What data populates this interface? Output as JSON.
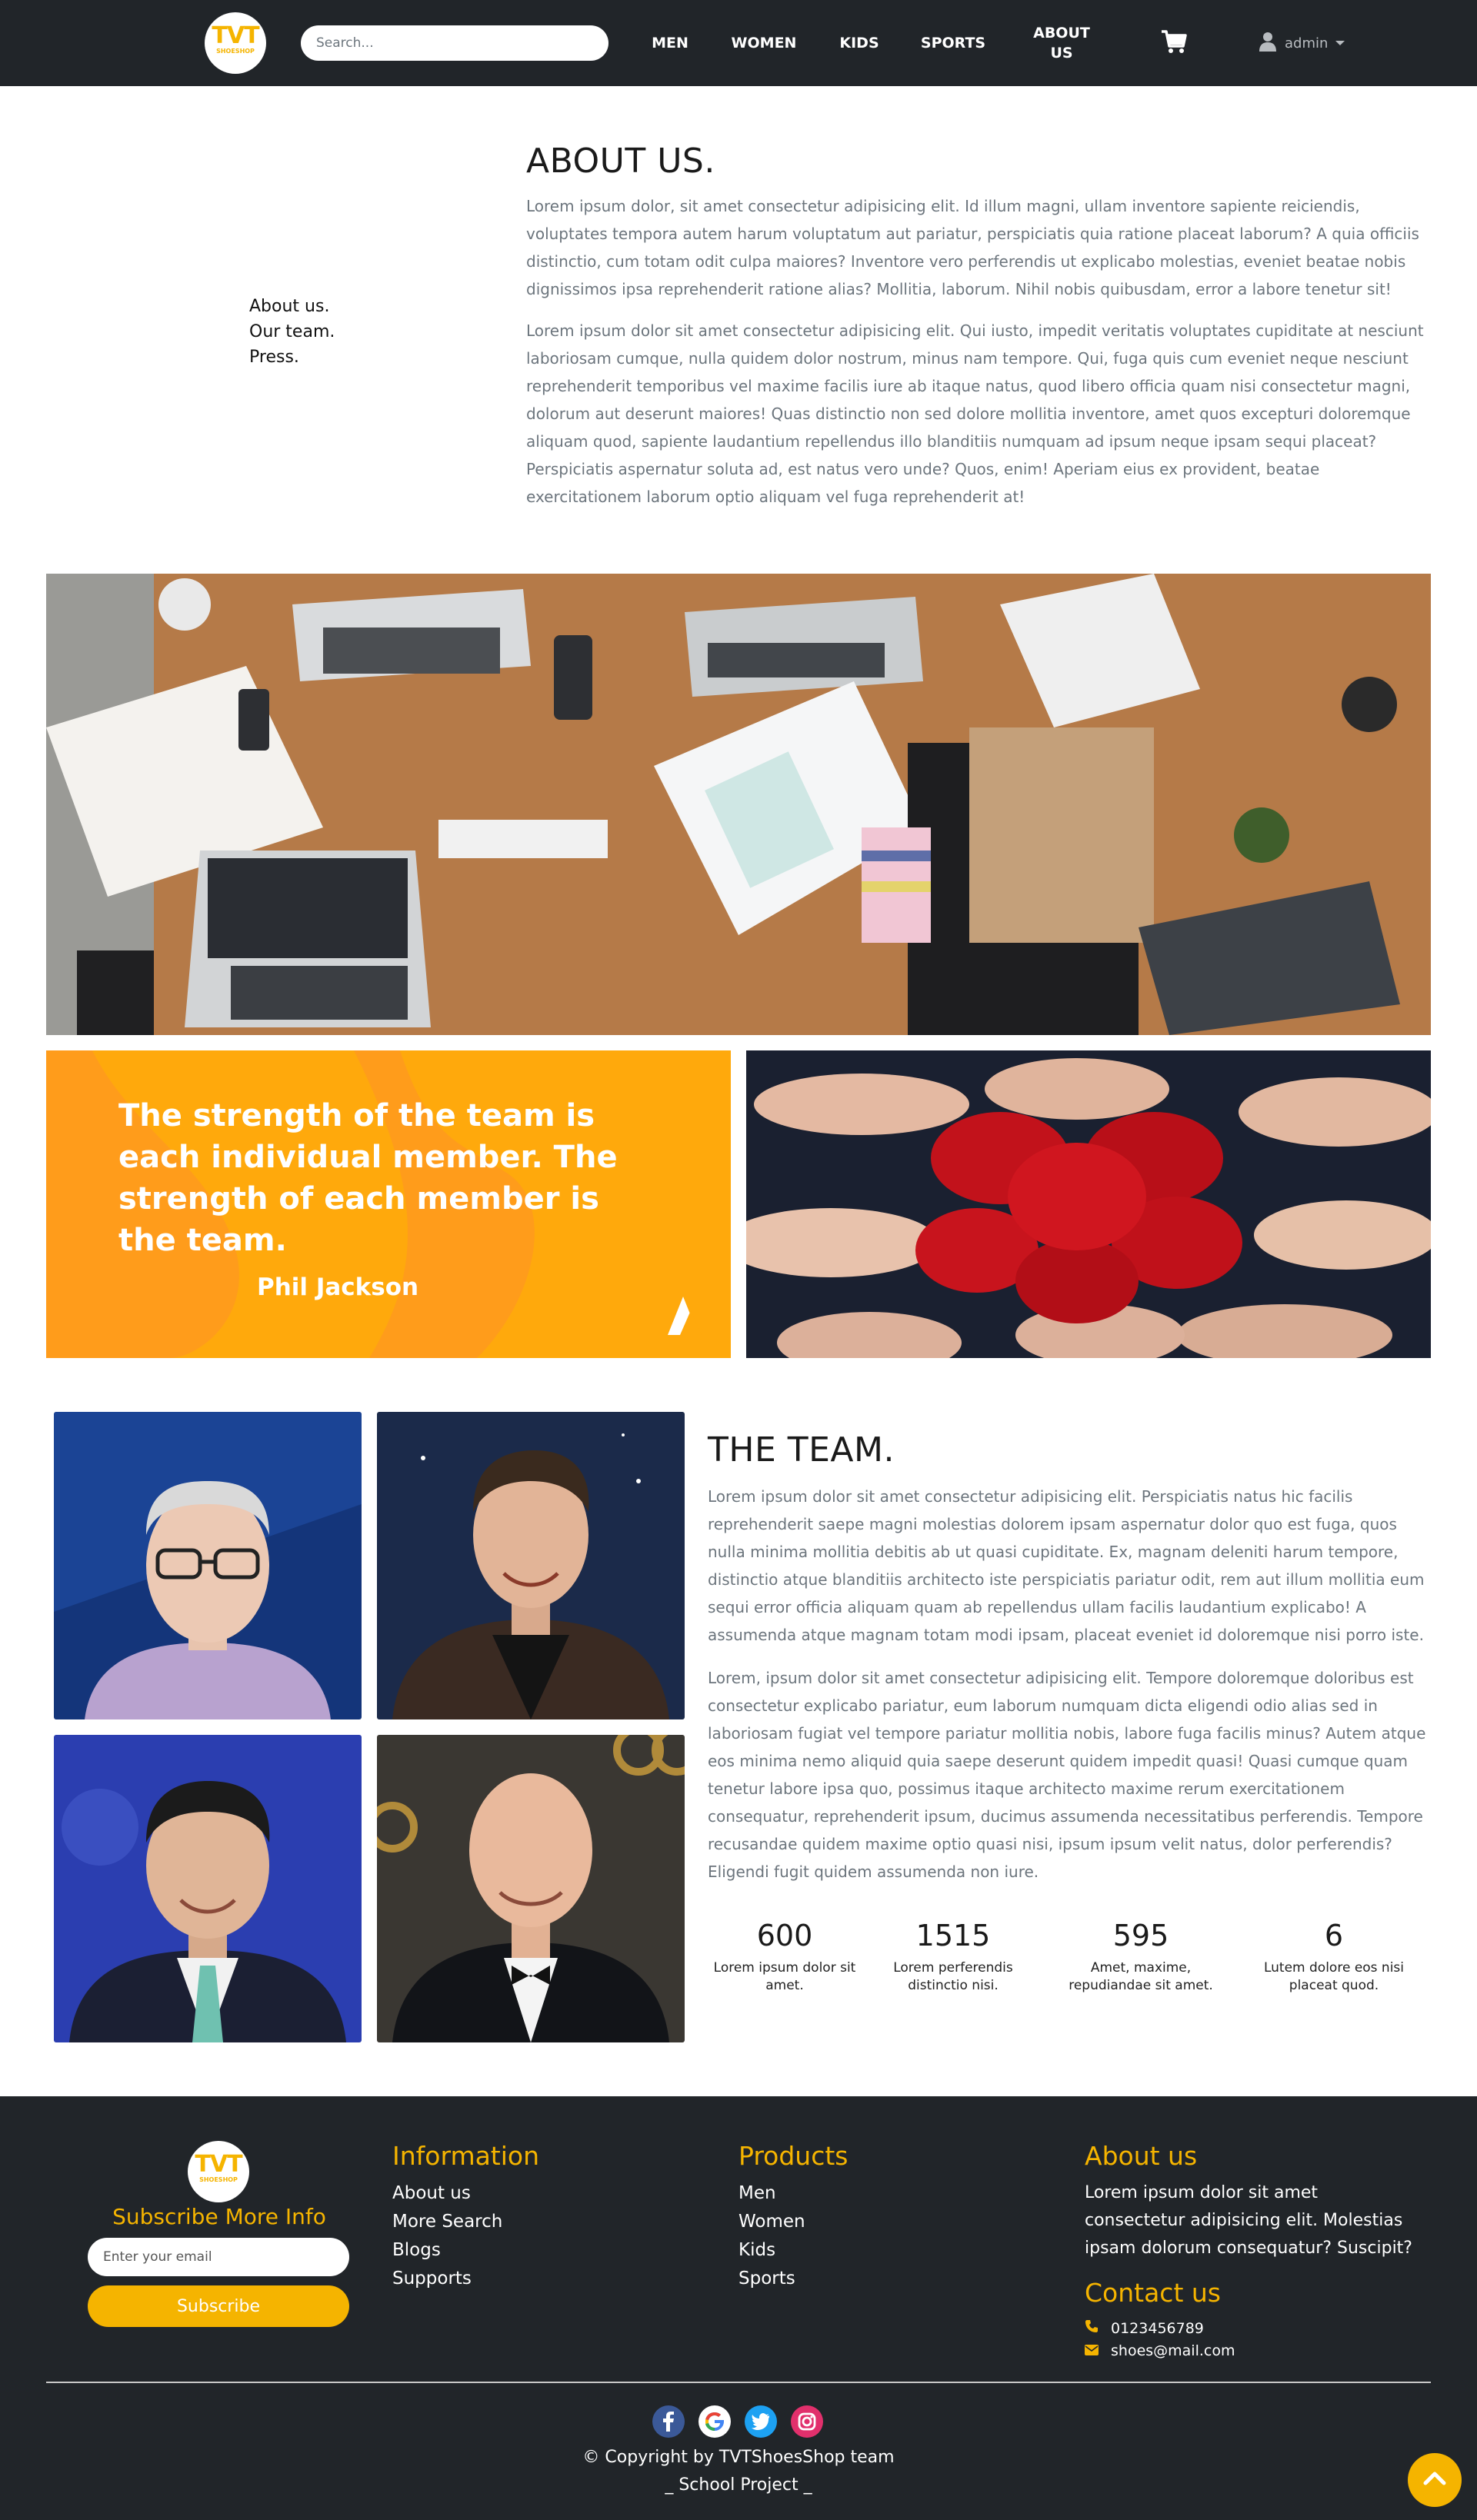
{
  "brand": {
    "logo_text": "TVT",
    "logo_sub": "SHOESHOP",
    "accent": "#f5b400",
    "dark": "#212529"
  },
  "navbar": {
    "search_placeholder": "Search...",
    "links": [
      {
        "label": "MEN"
      },
      {
        "label": "WOMEN"
      },
      {
        "label": "KIDS"
      },
      {
        "label": "SPORTS"
      },
      {
        "label": "ABOUT US"
      }
    ],
    "cart_icon": "cart-icon",
    "user_icon": "user-icon",
    "user_label": "admin"
  },
  "about": {
    "side_links": [
      "About us.",
      "Our team.",
      "Press."
    ],
    "title": "ABOUT US.",
    "paragraphs": [
      "Lorem ipsum dolor, sit amet consectetur adipisicing elit. Id illum magni, ullam inventore sapiente reiciendis, voluptates tempora autem harum voluptatum aut pariatur, perspiciatis quia ratione placeat laborum? A quia officiis distinctio, cum totam odit culpa maiores? Inventore vero perferendis ut explicabo molestias, eveniet beatae nobis dignissimos ipsa reprehenderit ratione alias? Mollitia, laborum. Nihil nobis quibusdam, error a labore tenetur sit!",
      "Lorem ipsum dolor sit amet consectetur adipisicing elit. Qui iusto, impedit veritatis voluptates cupiditate at nesciunt laboriosam cumque, nulla quidem dolor nostrum, minus nam tempore. Qui, fuga quis cum eveniet neque nesciunt reprehenderit temporibus vel maxime facilis iure ab itaque natus, quod libero officia quam nisi consectetur magni, dolorum aut deserunt maiores! Quas distinctio non sed dolore mollitia inventore, amet quos excepturi doloremque aliquam quod, sapiente laudantium repellendus illo blanditiis numquam ad ipsum neque ipsam sequi placeat? Perspiciatis aspernatur soluta ad, est natus vero unde? Quos, enim! Aperiam eius ex provident, beatae exercitationem laborum optio aliquam vel fuga reprehenderit at!"
    ]
  },
  "quote": {
    "text": "The strength of the team is each individual member. The strength of each member is the team.",
    "author": "Phil Jackson"
  },
  "team": {
    "title": "THE TEAM.",
    "paragraphs": [
      "Lorem ipsum dolor sit amet consectetur adipisicing elit. Perspiciatis natus hic facilis reprehenderit saepe magni molestias dolorem ipsam aspernatur dolor quo est fuga, quos nulla minima mollitia debitis ab ut quasi cupiditate. Ex, magnam deleniti harum tempore, distinctio atque blanditiis architecto iste perspiciatis pariatur odit, rem aut illum mollitia eum sequi error officia aliquam quam ab repellendus ullam facilis laudantium explicabo! A assumenda atque magnam totam modi ipsam, placeat eveniet id doloremque nisi porro iste.",
      "Lorem, ipsum dolor sit amet consectetur adipisicing elit. Tempore doloremque doloribus est consectetur explicabo pariatur, eum laborum numquam dicta eligendi odio alias sed in laboriosam fugiat vel tempore pariatur mollitia nobis, labore fuga facilis minus? Autem atque eos minima nemo aliquid quia saepe deserunt quidem impedit quasi! Quasi cumque quam tenetur labore ipsa quo, possimus itaque architecto maxime rerum exercitationem consequatur, reprehenderit ipsum, ducimus assumenda necessitatibus perferendis. Tempore recusandae quidem maxime optio quasi nisi, ipsum ipsum velit natus, dolor perferendis? Eligendi fugit quidem assumenda non iure."
    ],
    "stats": [
      {
        "value": "600",
        "label": "Lorem ipsum dolor sit amet."
      },
      {
        "value": "1515",
        "label": "Lorem perferendis distinctio nisi."
      },
      {
        "value": "595",
        "label": "Amet, maxime, repudiandae sit amet."
      },
      {
        "value": "6",
        "label": "Lutem dolore eos nisi placeat quod."
      }
    ]
  },
  "footer": {
    "subscribe_title": "Subscribe More Info",
    "email_placeholder": "Enter your email",
    "subscribe_button": "Subscribe",
    "information": {
      "title": "Information",
      "items": [
        "About us",
        "More Search",
        "Blogs",
        "Supports"
      ]
    },
    "products": {
      "title": "Products",
      "items": [
        "Men",
        "Women",
        "Kids",
        "Sports"
      ]
    },
    "about": {
      "title": "About us",
      "text": "Lorem ipsum dolor sit amet consectetur adipisicing elit. Molestias ipsam dolorum consequatur? Suscipit?"
    },
    "contact": {
      "title": "Contact us",
      "phone": "0123456789",
      "email": "shoes@mail.com"
    },
    "social_icons": [
      "facebook-icon",
      "google-icon",
      "twitter-icon",
      "instagram-icon"
    ],
    "copyright": "© Copyright by TVTShoesShop team",
    "tagline": "_ School Project _"
  }
}
